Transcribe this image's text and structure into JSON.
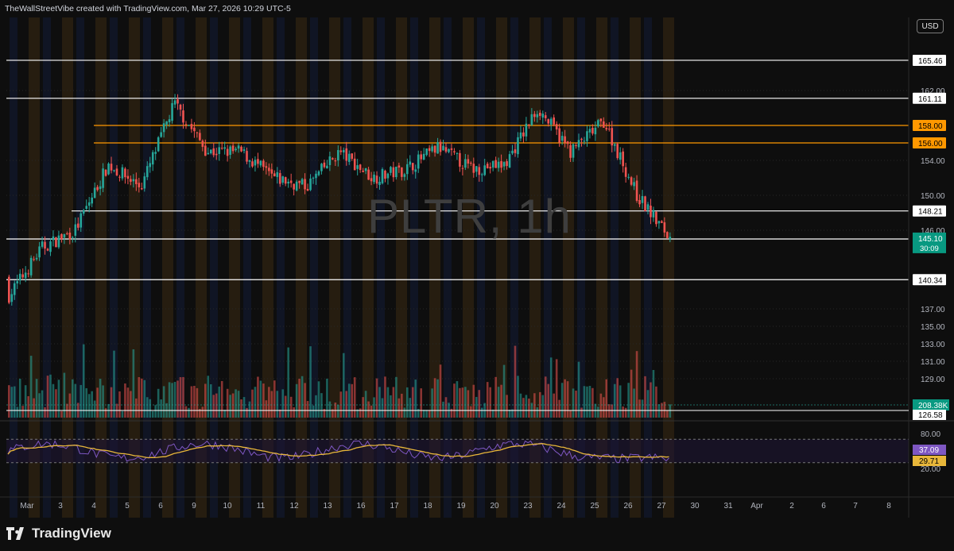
{
  "attribution": "TheWallStreetVibe created with TradingView.com, Mar 27, 2026 10:29 UTC-5",
  "currency_label": "USD",
  "watermark": "PLTR, 1h",
  "brand": "TradingView",
  "colors": {
    "bull": "#26a69a",
    "bear": "#ef5350",
    "resistance_orange": "#ff9800",
    "level_white": "#ffffff",
    "rsi_line": "#7e57c2",
    "rsi_ma": "#e8b73a",
    "last_price": "#089981"
  },
  "chart_data": [
    {
      "type": "candlestick",
      "symbol": "PLTR",
      "interval": "1h",
      "ylim": [
        119.5,
        170
      ],
      "y_tick_labels": [
        "162.00",
        "154.00",
        "150.00",
        "146.00",
        "137.00",
        "135.00",
        "133.00",
        "131.00",
        "129.00"
      ],
      "x_tick_labels": [
        "Mar",
        "3",
        "4",
        "5",
        "6",
        "9",
        "10",
        "11",
        "12",
        "13",
        "16",
        "17",
        "18",
        "19",
        "20",
        "23",
        "24",
        "25",
        "26",
        "27",
        "30",
        "31",
        "Apr",
        "2",
        "6",
        "7",
        "8"
      ],
      "approx_closes": [
        {
          "date": "Mar 2",
          "close": 138.5
        },
        {
          "date": "Mar 3",
          "close": 144
        },
        {
          "date": "Mar 4",
          "close": 146
        },
        {
          "date": "Mar 5",
          "close": 153.5
        },
        {
          "date": "Mar 6",
          "close": 151
        },
        {
          "date": "Mar 6 late",
          "close": 160.5
        },
        {
          "date": "Mar 9",
          "close": 155
        },
        {
          "date": "Mar 10",
          "close": 155
        },
        {
          "date": "Mar 11",
          "close": 152
        },
        {
          "date": "Mar 12",
          "close": 151
        },
        {
          "date": "Mar 13",
          "close": 155
        },
        {
          "date": "Mar 16",
          "close": 152
        },
        {
          "date": "Mar 17",
          "close": 153
        },
        {
          "date": "Mar 18",
          "close": 155.5
        },
        {
          "date": "Mar 19",
          "close": 153
        },
        {
          "date": "Mar 20",
          "close": 153.5
        },
        {
          "date": "Mar 23",
          "close": 160
        },
        {
          "date": "Mar 24",
          "close": 155
        },
        {
          "date": "Mar 25",
          "close": 158.5
        },
        {
          "date": "Mar 26",
          "close": 150
        },
        {
          "date": "Mar 27",
          "close": 145.1
        }
      ],
      "horizontal_levels": [
        {
          "value": 165.46,
          "label": "165.46",
          "color": "#ffffff"
        },
        {
          "value": 161.11,
          "label": "161.11",
          "color": "#ffffff"
        },
        {
          "value": 158.0,
          "label": "158.00",
          "color": "#ff9800"
        },
        {
          "value": 156.0,
          "label": "156.00",
          "color": "#ff9800"
        },
        {
          "value": 148.21,
          "label": "148.21",
          "color": "#ffffff"
        },
        {
          "value": 145.0,
          "label": "145.00",
          "color": "#ffffff"
        },
        {
          "value": 140.34,
          "label": "140.34",
          "color": "#ffffff"
        }
      ],
      "last_price": {
        "label": "145.10",
        "countdown": "30:09"
      },
      "volume": {
        "label": "208.38K"
      },
      "bottom_price_label": "126.58"
    },
    {
      "type": "line",
      "indicator": "RSI",
      "ylim": [
        0,
        100
      ],
      "y_tick_labels": [
        "80.00",
        "20.00"
      ],
      "bands": [
        70,
        30
      ],
      "series": [
        {
          "values_label": "37.09",
          "color": "#7e57c2"
        },
        {
          "values_label": "29.71",
          "color": "#e8b73a"
        }
      ]
    }
  ]
}
